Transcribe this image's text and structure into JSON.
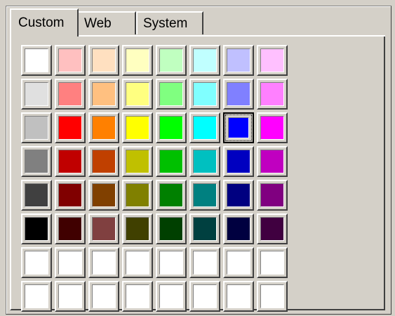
{
  "tabs": [
    {
      "label": "Custom",
      "active": true
    },
    {
      "label": "Web",
      "active": false
    },
    {
      "label": "System",
      "active": false
    }
  ],
  "palette": {
    "selected": {
      "row": 2,
      "col": 6
    },
    "rows": [
      [
        "#ffffff",
        "#ffc0c0",
        "#ffe0c0",
        "#ffffc0",
        "#c0ffc0",
        "#c0ffff",
        "#c0c0ff",
        "#ffc0ff"
      ],
      [
        "#e0e0e0",
        "#ff8080",
        "#ffc080",
        "#ffff80",
        "#80ff80",
        "#80ffff",
        "#8080ff",
        "#ff80ff"
      ],
      [
        "#c0c0c0",
        "#ff0000",
        "#ff8000",
        "#ffff00",
        "#00ff00",
        "#00ffff",
        "#0000ff",
        "#ff00ff"
      ],
      [
        "#808080",
        "#c00000",
        "#c04000",
        "#c0c000",
        "#00c000",
        "#00c0c0",
        "#0000c0",
        "#c000c0"
      ],
      [
        "#404040",
        "#800000",
        "#804000",
        "#808000",
        "#008000",
        "#008080",
        "#000080",
        "#800080"
      ],
      [
        "#000000",
        "#400000",
        "#804040",
        "#404000",
        "#004000",
        "#004040",
        "#000040",
        "#400040"
      ],
      [
        "#ffffff",
        "#ffffff",
        "#ffffff",
        "#ffffff",
        "#ffffff",
        "#ffffff",
        "#ffffff",
        "#ffffff"
      ],
      [
        "#ffffff",
        "#ffffff",
        "#ffffff",
        "#ffffff",
        "#ffffff",
        "#ffffff",
        "#ffffff",
        "#ffffff"
      ]
    ]
  }
}
